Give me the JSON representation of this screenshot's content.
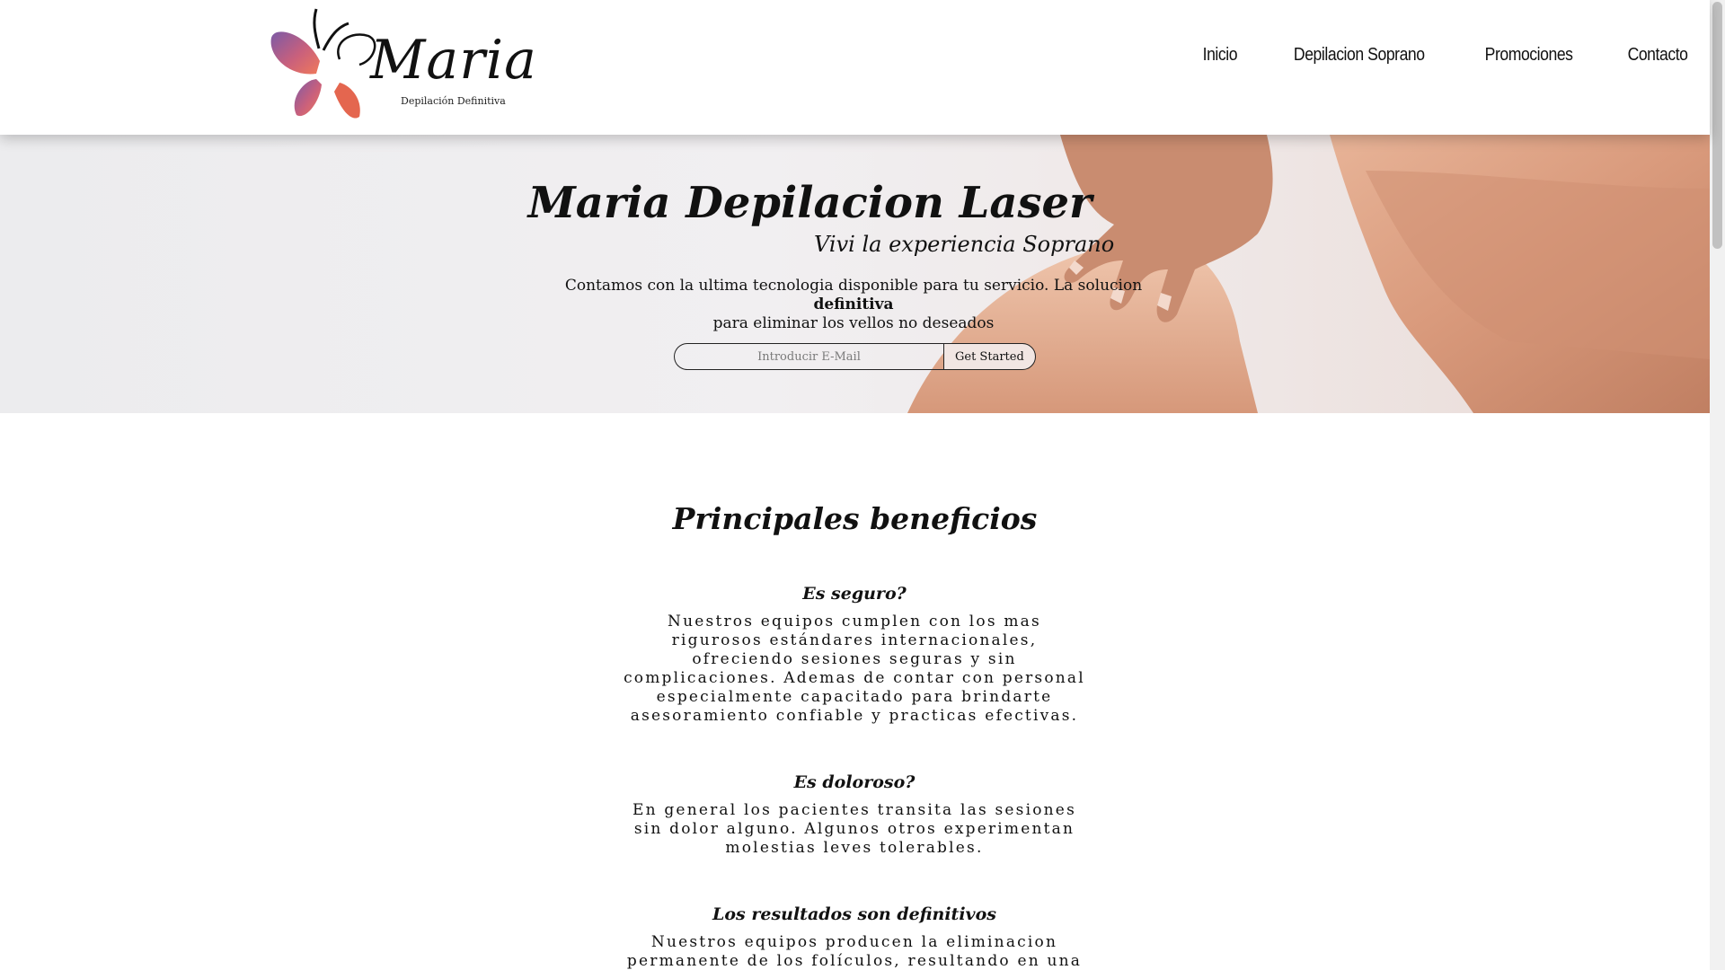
{
  "header": {
    "logo": {
      "wordmark": "Maria",
      "tagline": "Depilación Definitiva",
      "icon": "butterfly-icon"
    },
    "nav": [
      {
        "label": "Inicio"
      },
      {
        "label": "Depilacion Soprano"
      },
      {
        "label": "Promociones"
      },
      {
        "label": "Contacto"
      }
    ]
  },
  "hero": {
    "title": "Maria Depilacion Laser",
    "subtitle": "Vivi la experiencia Soprano",
    "text_before": "Contamos con la ultima tecnologia disponible para tu servicio. La solucion",
    "text_bold": "definitiva",
    "text_after": "para eliminar los vellos no deseados",
    "email_placeholder": "Introducir E-Mail",
    "button_label": "Get Started"
  },
  "benefits": {
    "title": "Principales beneficios",
    "items": [
      {
        "title": "Es seguro?",
        "text": "Nuestros equipos cumplen con los mas rigurosos estándares internacionales, ofreciendo sesiones seguras y sin complicaciones. Ademas de contar con personal especialmente capacitado para brindarte asesoramiento confiable y practicas efectivas."
      },
      {
        "title": "Es doloroso?",
        "text": "En general los pacientes transita las sesiones sin dolor alguno. Algunos otros experimentan molestias leves tolerables."
      },
      {
        "title": "Los resultados son definitivos",
        "text": "Nuestros equipos producen la eliminacion permanente de los folículos, resultando en una"
      }
    ]
  },
  "colors": {
    "brand_purple": "#8a5aa8",
    "brand_coral": "#e86a5a",
    "text": "#111111"
  }
}
